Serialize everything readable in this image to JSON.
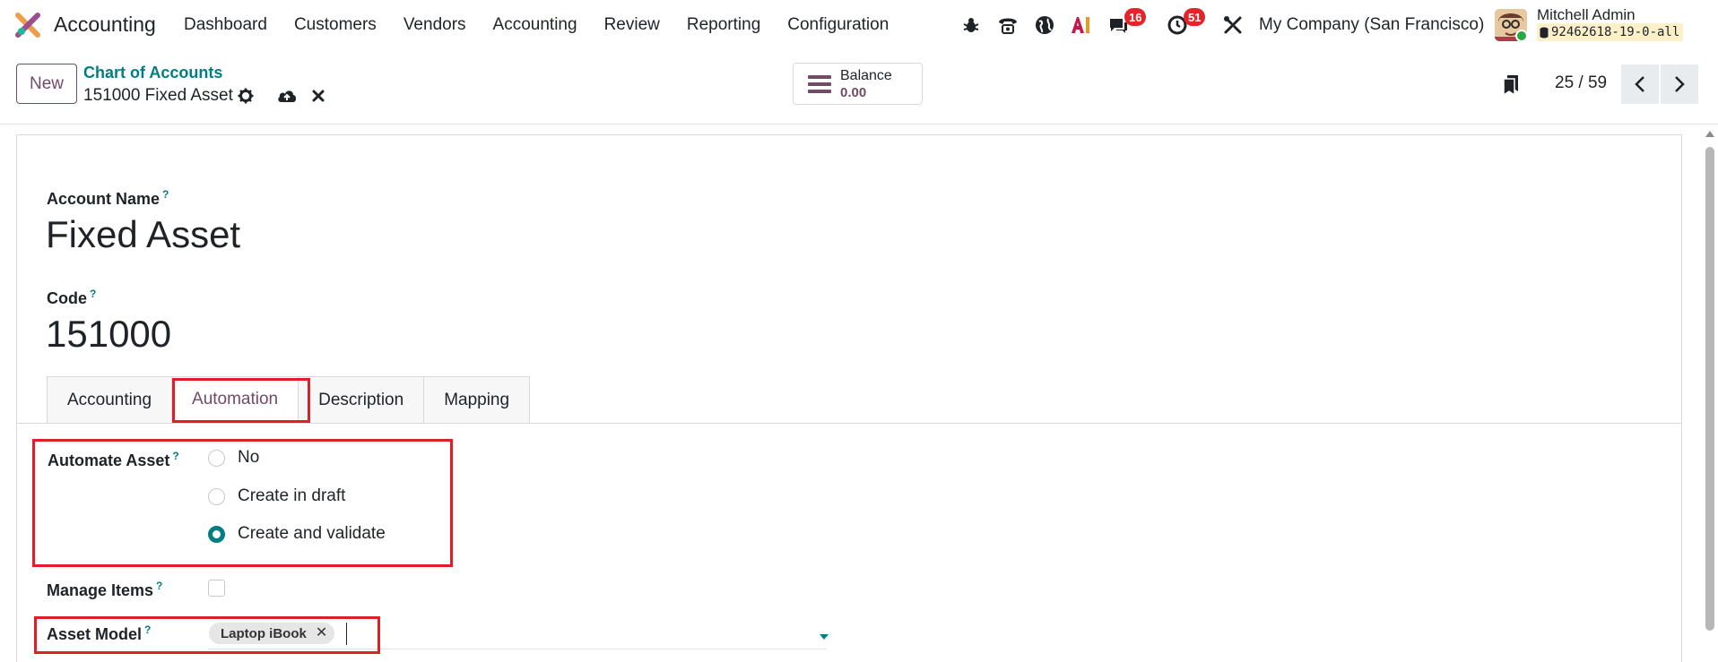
{
  "navbar": {
    "app_name": "Accounting",
    "menu": [
      "Dashboard",
      "Customers",
      "Vendors",
      "Accounting",
      "Review",
      "Reporting",
      "Configuration"
    ],
    "messages_count": "16",
    "activities_count": "51",
    "company": "My Company (San Francisco)",
    "user_name": "Mitchell Admin",
    "database": "92462618-19-0-all"
  },
  "control_panel": {
    "new_label": "New",
    "breadcrumb": "Chart of Accounts",
    "record_name": "151000 Fixed Asset",
    "balance_label": "Balance",
    "balance_value": "0.00",
    "pager": "25 / 59"
  },
  "form": {
    "account_name_label": "Account Name",
    "account_name": "Fixed Asset",
    "code_label": "Code",
    "code": "151000",
    "help_mark": "?",
    "tabs": [
      "Accounting",
      "Automation",
      "Description",
      "Mapping"
    ],
    "active_tab": "Automation",
    "automate_asset_label": "Automate Asset",
    "automate_asset_options": [
      "No",
      "Create in draft",
      "Create and validate"
    ],
    "automate_asset_selected": "Create and validate",
    "manage_items_label": "Manage Items",
    "manage_items_checked": false,
    "asset_model_label": "Asset Model",
    "asset_model_tags": [
      "Laptop iBook"
    ]
  },
  "colors": {
    "brand": "#714b67",
    "accent": "#017e84",
    "highlight": "#e01e26",
    "badge": "#e3242b"
  }
}
